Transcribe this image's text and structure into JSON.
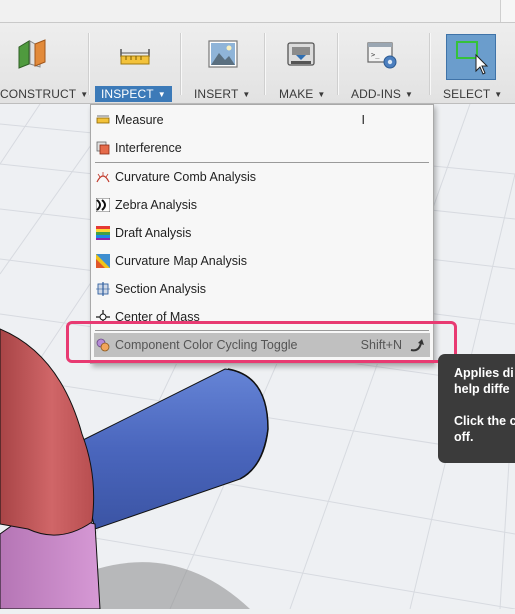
{
  "toolbar": {
    "groups": [
      {
        "label": "CONSTRUCT",
        "caret": "▼",
        "icon": "construct-plane-icon"
      },
      {
        "label": "INSPECT",
        "caret": "▼",
        "icon": "measure-ruler-icon",
        "active": true
      },
      {
        "label": "INSERT",
        "caret": "▼",
        "icon": "insert-image-icon"
      },
      {
        "label": "MAKE",
        "caret": "▼",
        "icon": "make-3d-print-icon"
      },
      {
        "label": "ADD-INS",
        "caret": "▼",
        "icon": "add-ins-script-icon"
      },
      {
        "label": "SELECT",
        "caret": "▼",
        "icon": "select-window-icon"
      }
    ]
  },
  "inspect_menu": {
    "items": [
      {
        "label": "Measure",
        "shortcut": "I",
        "icon": "measure-icon"
      },
      {
        "label": "Interference",
        "shortcut": "",
        "icon": "interference-icon"
      },
      {
        "label": "Curvature Comb Analysis",
        "shortcut": "",
        "icon": "curvature-comb-icon"
      },
      {
        "label": "Zebra Analysis",
        "shortcut": "",
        "icon": "zebra-icon"
      },
      {
        "label": "Draft Analysis",
        "shortcut": "",
        "icon": "draft-analysis-icon"
      },
      {
        "label": "Curvature Map Analysis",
        "shortcut": "",
        "icon": "curvature-map-icon"
      },
      {
        "label": "Section Analysis",
        "shortcut": "",
        "icon": "section-analysis-icon"
      },
      {
        "label": "Center of Mass",
        "shortcut": "",
        "icon": "center-of-mass-icon"
      },
      {
        "label": "Component Color Cycling Toggle",
        "shortcut": "Shift+N",
        "icon": "component-color-icon",
        "highlighted": true
      }
    ]
  },
  "tooltip": {
    "line1": "Applies di",
    "line2": "help diffe",
    "line3": "Click the c",
    "line4": "off."
  },
  "colors": {
    "accent": "#3c7ab8",
    "annotation": "#e83a72",
    "menu_highlight": "#c0c0c0",
    "tooltip_bg": "#3b3b3b",
    "cylinder_red": "#c85a5c",
    "cylinder_blue": "#4e6fc6",
    "cylinder_pink": "#c785c6"
  }
}
